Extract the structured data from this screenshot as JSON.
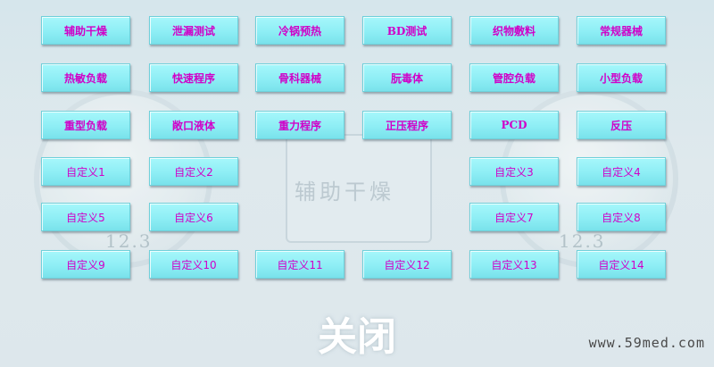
{
  "background": {
    "readout_left": "12.3",
    "readout_right": "12.3",
    "center_label": "辅助干燥"
  },
  "rows": [
    [
      "辅助干燥",
      "泄漏测试",
      "冷锅预热",
      "BD测试",
      "织物敷料",
      "常规器械"
    ],
    [
      "热敏负载",
      "快速程序",
      "骨科器械",
      "朊毒体",
      "管腔负载",
      "小型负载"
    ],
    [
      "重型负载",
      "敞口液体",
      "重力程序",
      "正压程序",
      "PCD",
      "反压"
    ],
    [
      "自定义1",
      "自定义2",
      "自定义3",
      "自定义4"
    ],
    [
      "自定义5",
      "自定义6",
      "自定义7",
      "自定义8"
    ],
    [
      "自定义9",
      "自定义10",
      "自定义11",
      "自定义12",
      "自定义13",
      "自定义14"
    ]
  ],
  "close_label": "关闭",
  "watermark": "www.59med.com",
  "colors": {
    "button_text": "#d000c8",
    "button_fill": "#8eeef5",
    "close_text": "#ffffff"
  }
}
